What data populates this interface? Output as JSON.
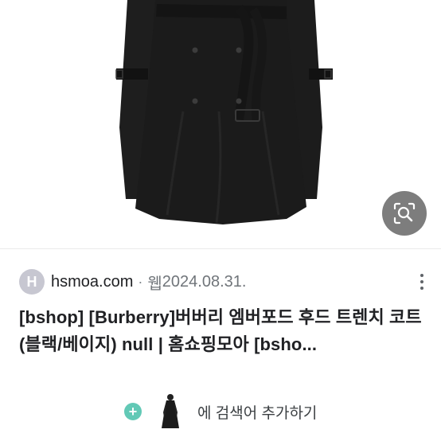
{
  "image": {
    "subject": "black hooded trench coat",
    "lens_button_icon": "image-search-icon"
  },
  "source": {
    "favicon_letter": "H",
    "domain": "hsmoa.com",
    "separator": "·",
    "type": "웹",
    "date": "2024.08.31.",
    "more_icon": "more-vert-icon"
  },
  "result": {
    "title": "[bshop] [Burberry]버버리 엠버포드 후드 트렌치 코트 (블랙/베이지) null | 홈쇼핑모아 [bsho..."
  },
  "search_add": {
    "plus_symbol": "+",
    "label": "에 검색어 추가하기"
  },
  "colors": {
    "coat": "#1b1b1b",
    "lens_button_bg": "#7d7d7d",
    "plus_bg": "#62c9b6",
    "favicon_bg": "#c7c7d1"
  }
}
